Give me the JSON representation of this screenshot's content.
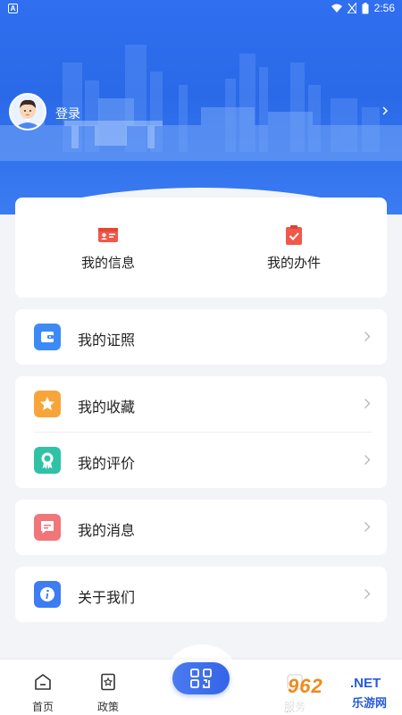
{
  "status_bar": {
    "time": "2:56",
    "app_badge": "A"
  },
  "header": {
    "login_label": "登录"
  },
  "quick_actions": [
    {
      "label": "我的信息"
    },
    {
      "label": "我的办件"
    }
  ],
  "menu_groups": [
    [
      {
        "label": "我的证照"
      }
    ],
    [
      {
        "label": "我的收藏"
      },
      {
        "label": "我的评价"
      }
    ],
    [
      {
        "label": "我的消息"
      }
    ],
    [
      {
        "label": "关于我们"
      }
    ]
  ],
  "bottom_nav": [
    {
      "label": "首页"
    },
    {
      "label": "政策"
    },
    {
      "label": "服务"
    }
  ],
  "watermark": {
    "main": "962",
    "net": ".NET",
    "sub": "乐游网"
  },
  "colors": {
    "primary": "#2f6ff0",
    "license_icon": "#3d8af7",
    "favorite_icon": "#f7a53a",
    "review_icon": "#2fc2a6",
    "message_icon": "#f0767a",
    "about_icon": "#3d7cf2",
    "quick_red": "#f0594a"
  }
}
